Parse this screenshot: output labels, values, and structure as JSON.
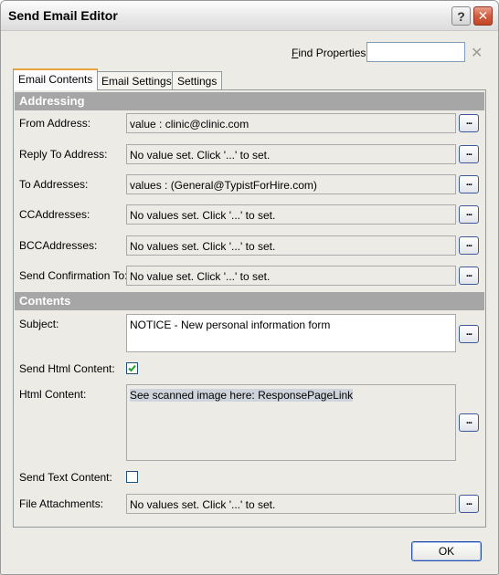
{
  "window": {
    "title": "Send Email Editor"
  },
  "titlebar": {
    "help_glyph": "?",
    "close_glyph": "✕"
  },
  "find": {
    "label": "Find Properties",
    "value": "",
    "clear_glyph": "✕"
  },
  "tabs": [
    {
      "label": "Email Contents",
      "active": true
    },
    {
      "label": "Email Settings",
      "active": false
    },
    {
      "label": "Settings",
      "active": false
    }
  ],
  "addressing": {
    "header": "Addressing",
    "rows": [
      {
        "label": "From Address:",
        "value": "value : clinic@clinic.com"
      },
      {
        "label": "Reply To Address:",
        "value": "No value set. Click '...' to set."
      },
      {
        "label": "To Addresses:",
        "value": "values : (General@TypistForHire.com)"
      },
      {
        "label": "CCAddresses:",
        "value": "No values set. Click '...' to set."
      },
      {
        "label": "BCCAddresses:",
        "value": "No values set. Click '...' to set."
      },
      {
        "label": "Send Confirmation To:",
        "value": "No value set. Click '...' to set."
      }
    ]
  },
  "contents": {
    "header": "Contents",
    "subject_label": "Subject:",
    "subject_value": "NOTICE - New personal information form",
    "send_html_label": "Send Html Content:",
    "send_html_checked": true,
    "html_content_label": "Html Content:",
    "html_content_value": "See scanned image here:  ResponsePageLink",
    "send_text_label": "Send Text Content:",
    "send_text_checked": false,
    "attachments_label": "File Attachments:",
    "attachments_value": "No values set. Click '...' to set."
  },
  "button_dots_label": "...",
  "buttons": {
    "ok": "OK"
  }
}
